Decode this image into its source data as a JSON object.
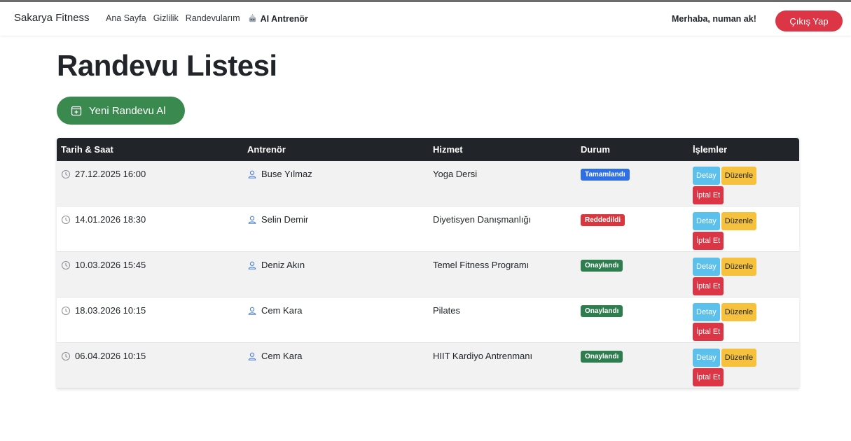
{
  "navbar": {
    "brand": "Sakarya Fitness",
    "links": [
      "Ana Sayfa",
      "Gizlilik",
      "Randevularım"
    ],
    "ai_link": "AI Antrenör",
    "greeting": "Merhaba, numan ak!",
    "logout_label": "Çıkış Yap"
  },
  "page": {
    "title": "Randevu Listesi",
    "new_button_label": "Yeni Randevu Al"
  },
  "table": {
    "headers": [
      "Tarih & Saat",
      "Antrenör",
      "Hizmet",
      "Durum",
      "İşlemler"
    ],
    "rows": [
      {
        "datetime": "27.12.2025 16:00",
        "trainer": "Buse Yılmaz",
        "service": "Yoga Dersi",
        "status": "Tamamlandı",
        "status_color": "#2f6fe4"
      },
      {
        "datetime": "14.01.2026 18:30",
        "trainer": "Selin Demir",
        "service": "Diyetisyen Danışmanlığı",
        "status": "Reddedildi",
        "status_color": "#d9363e"
      },
      {
        "datetime": "10.03.2026 15:45",
        "trainer": "Deniz Akın",
        "service": "Temel Fitness Programı",
        "status": "Onaylandı",
        "status_color": "#2e7d4f"
      },
      {
        "datetime": "18.03.2026 10:15",
        "trainer": "Cem Kara",
        "service": "Pilates",
        "status": "Onaylandı",
        "status_color": "#2e7d4f"
      },
      {
        "datetime": "06.04.2026 10:15",
        "trainer": "Cem Kara",
        "service": "HIIT Kardiyo Antrenmanı",
        "status": "Onaylandı",
        "status_color": "#2e7d4f"
      }
    ],
    "actions": {
      "detail": "Detay",
      "edit": "Düzenle",
      "cancel": "İptal Et"
    }
  },
  "icons": {
    "ai": "robot-icon",
    "new_button": "calendar-plus-icon",
    "datetime": "clock-icon",
    "trainer": "person-icon"
  },
  "colors": {
    "danger": "#dc3545",
    "success_button": "#3a8a4f",
    "header_dark": "#212529",
    "info": "#5bc0ec",
    "warning": "#f6c23e"
  }
}
